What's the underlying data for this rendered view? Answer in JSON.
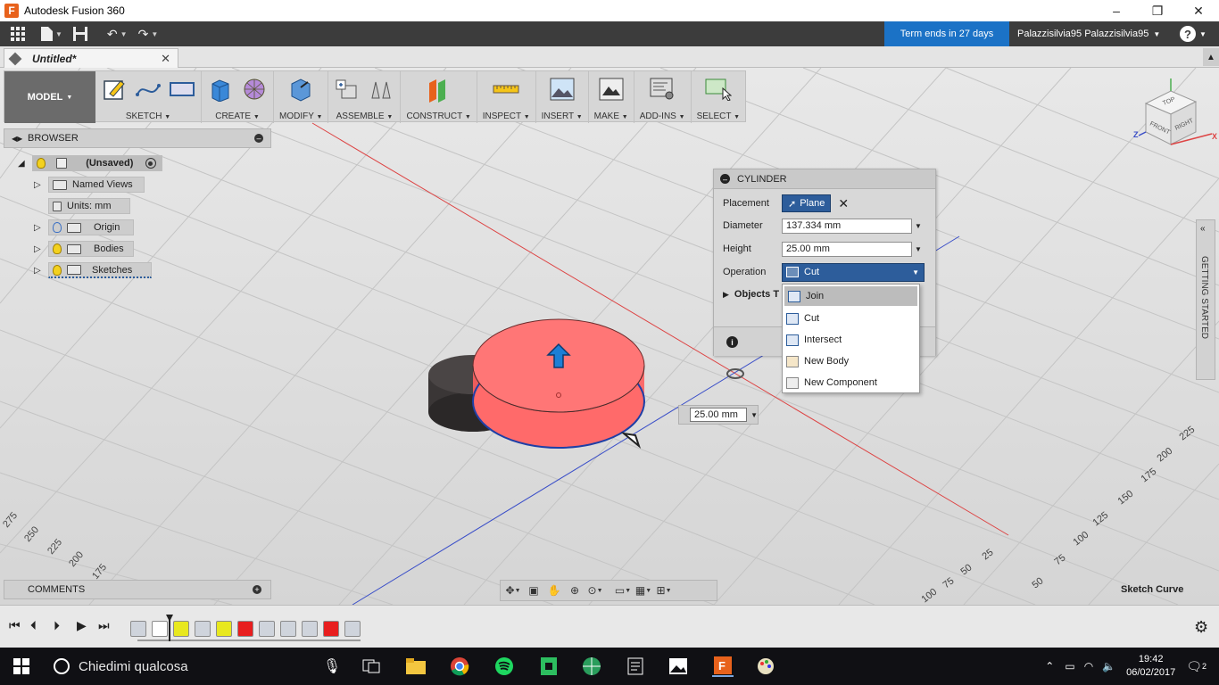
{
  "window": {
    "title": "Autodesk Fusion 360",
    "controls": {
      "minimize": "–",
      "maximize": "❐",
      "close": "✕"
    }
  },
  "qat": {
    "term_notice": "Term ends in 27 days",
    "user_name": "Palazzisilvia95 Palazzisilvia95"
  },
  "document_tab": {
    "title": "Untitled*"
  },
  "toolbar": {
    "workspace": "MODEL",
    "groups": [
      "SKETCH",
      "CREATE",
      "MODIFY",
      "ASSEMBLE",
      "CONSTRUCT",
      "INSPECT",
      "INSERT",
      "MAKE",
      "ADD-INS",
      "SELECT"
    ]
  },
  "browser": {
    "title": "BROWSER",
    "root": "(Unsaved)",
    "named_views": "Named Views",
    "units": "Units: mm",
    "origin": "Origin",
    "bodies": "Bodies",
    "sketches": "Sketches"
  },
  "viewcube": {
    "top": "TOP",
    "front": "FRONT",
    "right": "RIGHT",
    "axis_x": "X",
    "axis_z": "Z"
  },
  "cylinder_dialog": {
    "title": "CYLINDER",
    "placement_label": "Placement",
    "placement_value": "Plane",
    "diameter_label": "Diameter",
    "diameter_value": "137.334 mm",
    "height_label": "Height",
    "height_value": "25.00 mm",
    "operation_label": "Operation",
    "operation_value": "Cut",
    "objects_label": "Objects T",
    "operation_options": [
      "Join",
      "Cut",
      "Intersect",
      "New Body",
      "New Component"
    ]
  },
  "dimension_input": {
    "value": "25.00 mm"
  },
  "side_panel": {
    "getting_started": "GETTING STARTED"
  },
  "comments": {
    "title": "COMMENTS"
  },
  "status": {
    "selection": "Sketch Curve"
  },
  "grid_labels": {
    "right": [
      "225",
      "200",
      "175",
      "150",
      "125",
      "100",
      "75",
      "50",
      "25"
    ],
    "right_lower": [
      "25",
      "50",
      "75",
      "100"
    ],
    "left": [
      "275",
      "250",
      "225",
      "200",
      "175"
    ]
  },
  "taskbar": {
    "search_placeholder": "Chiedimi qualcosa",
    "time": "19:42",
    "date": "06/02/2017",
    "notifications": "2"
  },
  "colors": {
    "accent_blue": "#1b72c6",
    "cylinder_red": "#ff5a5a",
    "selection_blue": "#2d5d9b",
    "timeline_yellow": "#e8e81e",
    "timeline_red": "#e81e1e"
  }
}
